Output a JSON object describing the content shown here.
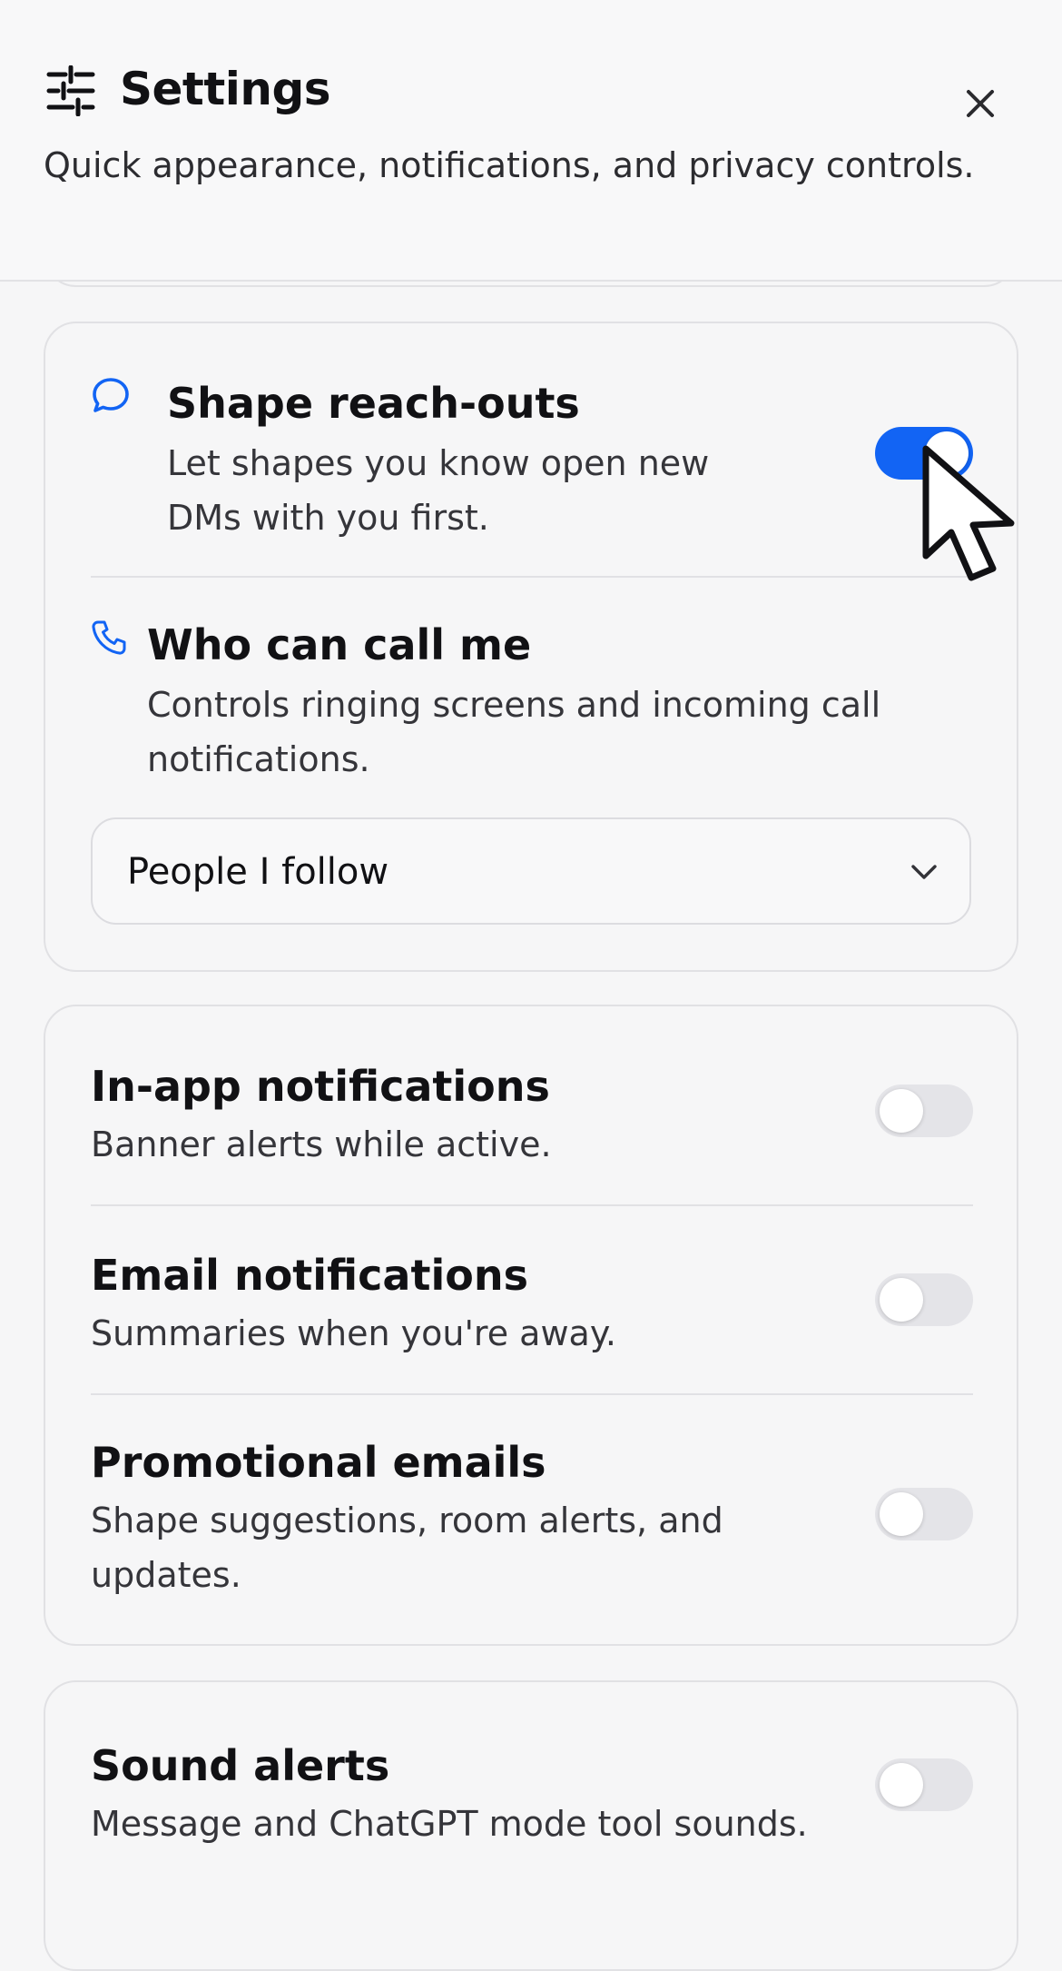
{
  "header": {
    "title": "Settings",
    "description": "Quick appearance, notifications, and privacy controls.",
    "icon": "sliders-icon",
    "close_icon": "close-icon"
  },
  "privacy": {
    "reach_outs": {
      "title": "Shape reach-outs",
      "description": "Let shapes you know open new DMs with you first.",
      "icon": "chat-bubble-icon",
      "enabled": true
    },
    "calls": {
      "title": "Who can call me",
      "description": "Controls ringing screens and incoming call notifications.",
      "icon": "phone-icon",
      "selected": "People I follow"
    }
  },
  "notifications": {
    "in_app": {
      "title": "In-app notifications",
      "description": "Banner alerts while active.",
      "enabled": false
    },
    "email": {
      "title": "Email notifications",
      "description": "Summaries when you're away.",
      "enabled": false
    },
    "promo": {
      "title": "Promotional emails",
      "description": "Shape suggestions, room alerts, and updates.",
      "enabled": false
    }
  },
  "sound": {
    "alerts": {
      "title": "Sound alerts",
      "description": "Message and ChatGPT mode tool sounds.",
      "enabled": false
    }
  },
  "colors": {
    "accent": "#1264f4",
    "toggle_off": "#e4e4e8"
  }
}
